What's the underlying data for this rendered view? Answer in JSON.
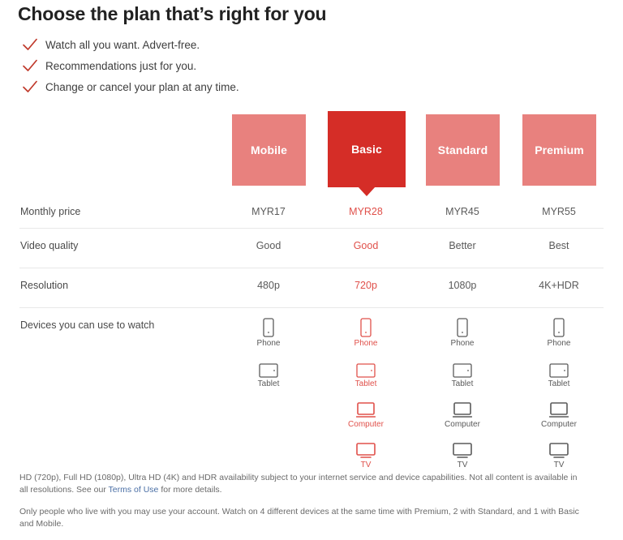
{
  "headline": "Choose the plan that’s right for you",
  "bullets": [
    {
      "icon": "check-icon",
      "text": "Watch all you want. Advert-free."
    },
    {
      "icon": "check-icon",
      "text": "Recommendations just for you."
    },
    {
      "icon": "check-icon",
      "text": "Change or cancel your plan at any time."
    }
  ],
  "colors": {
    "card": "#e8817e",
    "card_selected": "#d52d27",
    "accent_text": "#e0504a",
    "link": "#4a6fa5",
    "divider": "#e8e8e8"
  },
  "plans": [
    {
      "name": "Mobile",
      "selected": false
    },
    {
      "name": "Basic",
      "selected": true
    },
    {
      "name": "Standard",
      "selected": false
    },
    {
      "name": "Premium",
      "selected": false
    }
  ],
  "rows": {
    "price": {
      "label": "Monthly price",
      "values": [
        "MYR17",
        "MYR28",
        "MYR45",
        "MYR55"
      ]
    },
    "quality": {
      "label": "Video quality",
      "values": [
        "Good",
        "Good",
        "Better",
        "Best"
      ]
    },
    "resolution": {
      "label": "Resolution",
      "values": [
        "480p",
        "720p",
        "1080p",
        "4K+HDR"
      ]
    },
    "devices": {
      "label": "Devices you can use to watch",
      "columns": [
        [
          {
            "icon": "phone-icon",
            "label": "Phone"
          },
          {
            "icon": "tablet-icon",
            "label": "Tablet"
          }
        ],
        [
          {
            "icon": "phone-icon",
            "label": "Phone"
          },
          {
            "icon": "tablet-icon",
            "label": "Tablet"
          },
          {
            "icon": "computer-icon",
            "label": "Computer"
          },
          {
            "icon": "tv-icon",
            "label": "TV"
          }
        ],
        [
          {
            "icon": "phone-icon",
            "label": "Phone"
          },
          {
            "icon": "tablet-icon",
            "label": "Tablet"
          },
          {
            "icon": "computer-icon",
            "label": "Computer"
          },
          {
            "icon": "tv-icon",
            "label": "TV"
          }
        ],
        [
          {
            "icon": "phone-icon",
            "label": "Phone"
          },
          {
            "icon": "tablet-icon",
            "label": "Tablet"
          },
          {
            "icon": "computer-icon",
            "label": "Computer"
          },
          {
            "icon": "tv-icon",
            "label": "TV"
          }
        ]
      ]
    }
  },
  "footer": {
    "note1_before": "HD (720p), Full HD (1080p), Ultra HD (4K) and HDR availability subject to your internet service and device capabilities. Not all content is available in all resolutions. See our ",
    "note1_link": "Terms of Use",
    "note1_after": " for more details.",
    "note2": "Only people who live with you may use your account. Watch on 4 different devices at the same time with Premium, 2 with Standard, and 1 with Basic and Mobile."
  }
}
